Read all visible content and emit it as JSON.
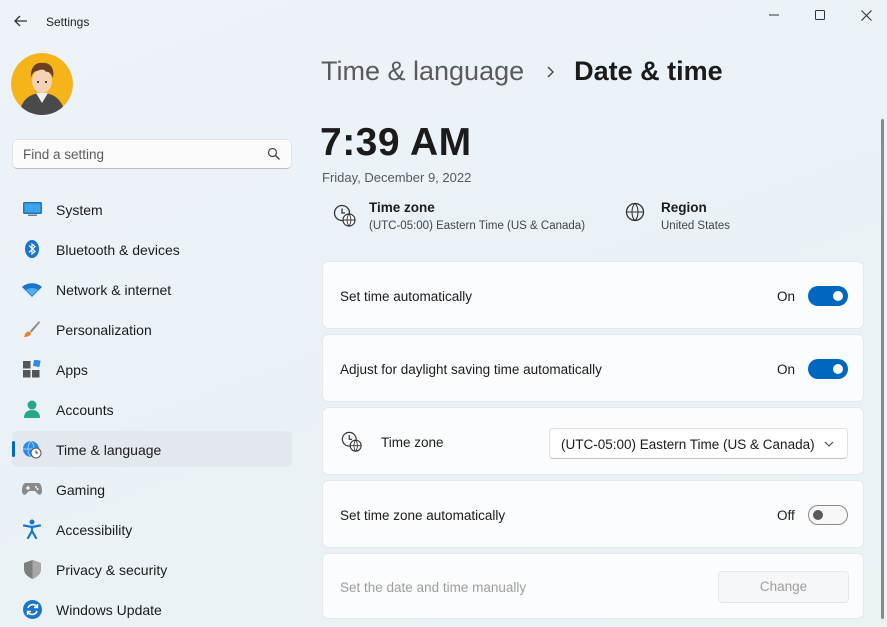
{
  "window": {
    "title": "Settings",
    "controls": {
      "minimize_icon": "minimize-icon",
      "maximize_icon": "maximize-icon",
      "close_icon": "close-icon"
    }
  },
  "search": {
    "placeholder": "Find a setting",
    "value": ""
  },
  "sidebar": {
    "items": [
      {
        "label": "System",
        "icon": "system-icon"
      },
      {
        "label": "Bluetooth & devices",
        "icon": "bluetooth-icon"
      },
      {
        "label": "Network & internet",
        "icon": "wifi-icon"
      },
      {
        "label": "Personalization",
        "icon": "paintbrush-icon"
      },
      {
        "label": "Apps",
        "icon": "apps-icon"
      },
      {
        "label": "Accounts",
        "icon": "person-icon"
      },
      {
        "label": "Time & language",
        "icon": "globe-clock-icon",
        "selected": true
      },
      {
        "label": "Gaming",
        "icon": "gamepad-icon"
      },
      {
        "label": "Accessibility",
        "icon": "accessibility-icon"
      },
      {
        "label": "Privacy & security",
        "icon": "shield-icon"
      },
      {
        "label": "Windows Update",
        "icon": "update-icon"
      }
    ]
  },
  "header": {
    "parent": "Time & language",
    "current": "Date & time"
  },
  "clock": {
    "time": "7:39 AM",
    "date": "Friday, December 9, 2022"
  },
  "info": {
    "timezone": {
      "title": "Time zone",
      "value": "(UTC-05:00) Eastern Time (US & Canada)"
    },
    "region": {
      "title": "Region",
      "value": "United States"
    }
  },
  "settings": {
    "set_time_auto": {
      "label": "Set time automatically",
      "state": "On"
    },
    "daylight_saving": {
      "label": "Adjust for daylight saving time automatically",
      "state": "On"
    },
    "time_zone": {
      "label": "Time zone",
      "selected": "(UTC-05:00) Eastern Time (US & Canada)"
    },
    "set_tz_auto": {
      "label": "Set time zone automatically",
      "state": "Off"
    },
    "manual": {
      "label": "Set the date and time manually",
      "button": "Change"
    }
  },
  "colors": {
    "accent": "#0067c0",
    "disabled_text": "#9e9e9e"
  }
}
